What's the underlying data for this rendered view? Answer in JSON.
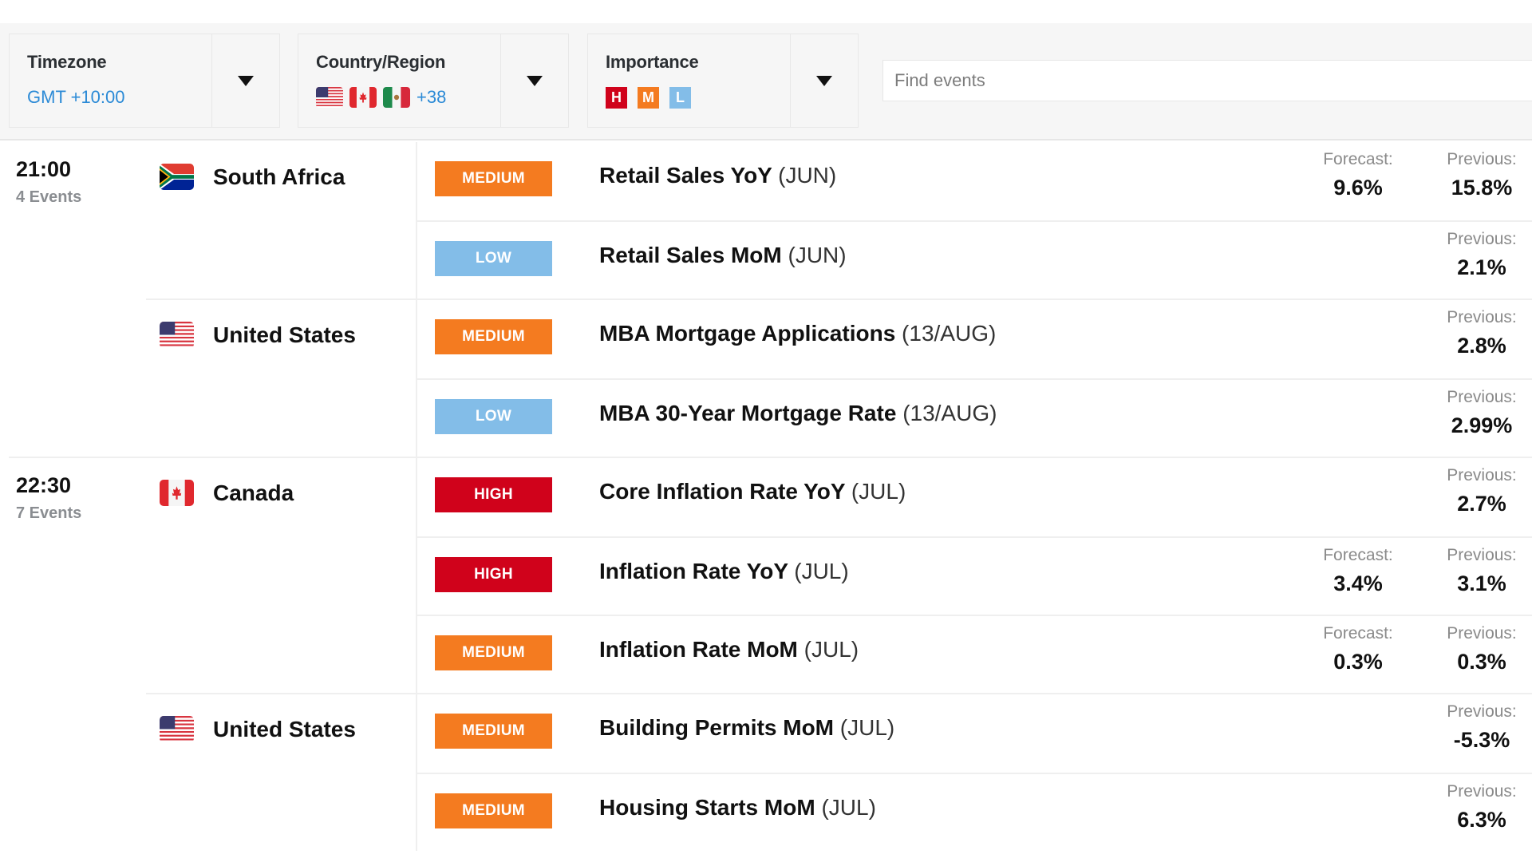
{
  "filters": {
    "timezone": {
      "label": "Timezone",
      "value": "GMT +10:00"
    },
    "country": {
      "label": "Country/Region",
      "flags": [
        "united-states",
        "canada",
        "mexico"
      ],
      "more": "+38"
    },
    "importance": {
      "label": "Importance",
      "chips": [
        {
          "letter": "H",
          "level": "high",
          "color": "#d0021b"
        },
        {
          "letter": "M",
          "level": "medium",
          "color": "#f47b20"
        },
        {
          "letter": "L",
          "level": "low",
          "color": "#83bde8"
        }
      ]
    },
    "search": {
      "placeholder": "Find events",
      "value": ""
    }
  },
  "colors": {
    "high": "#d0021b",
    "medium": "#f47b20",
    "low": "#83bde8",
    "link": "#2b8ad6"
  },
  "stat_labels": {
    "forecast": "Forecast:",
    "previous": "Previous:"
  },
  "groups": [
    {
      "time": "21:00",
      "count": "4 Events",
      "countries": [
        {
          "name": "South Africa",
          "flag": "south-africa",
          "events": [
            {
              "importance": "MEDIUM",
              "level": "medium",
              "name": "Retail Sales YoY",
              "period": "(JUN)",
              "forecast": "9.6%",
              "previous": "15.8%"
            },
            {
              "importance": "LOW",
              "level": "low",
              "name": "Retail Sales MoM",
              "period": "(JUN)",
              "forecast": null,
              "previous": "2.1%"
            }
          ]
        },
        {
          "name": "United States",
          "flag": "united-states",
          "events": [
            {
              "importance": "MEDIUM",
              "level": "medium",
              "name": "MBA Mortgage Applications",
              "period": "(13/AUG)",
              "forecast": null,
              "previous": "2.8%"
            },
            {
              "importance": "LOW",
              "level": "low",
              "name": "MBA 30-Year Mortgage Rate",
              "period": "(13/AUG)",
              "forecast": null,
              "previous": "2.99%"
            }
          ]
        }
      ]
    },
    {
      "time": "22:30",
      "count": "7 Events",
      "countries": [
        {
          "name": "Canada",
          "flag": "canada",
          "events": [
            {
              "importance": "HIGH",
              "level": "high",
              "name": "Core Inflation Rate YoY",
              "period": "(JUL)",
              "forecast": null,
              "previous": "2.7%"
            },
            {
              "importance": "HIGH",
              "level": "high",
              "name": "Inflation Rate YoY",
              "period": "(JUL)",
              "forecast": "3.4%",
              "previous": "3.1%"
            },
            {
              "importance": "MEDIUM",
              "level": "medium",
              "name": "Inflation Rate MoM",
              "period": "(JUL)",
              "forecast": "0.3%",
              "previous": "0.3%"
            }
          ]
        },
        {
          "name": "United States",
          "flag": "united-states",
          "events": [
            {
              "importance": "MEDIUM",
              "level": "medium",
              "name": "Building Permits MoM",
              "period": "(JUL)",
              "forecast": null,
              "previous": "-5.3%"
            },
            {
              "importance": "MEDIUM",
              "level": "medium",
              "name": "Housing Starts MoM",
              "period": "(JUL)",
              "forecast": null,
              "previous": "6.3%"
            }
          ]
        }
      ]
    }
  ]
}
